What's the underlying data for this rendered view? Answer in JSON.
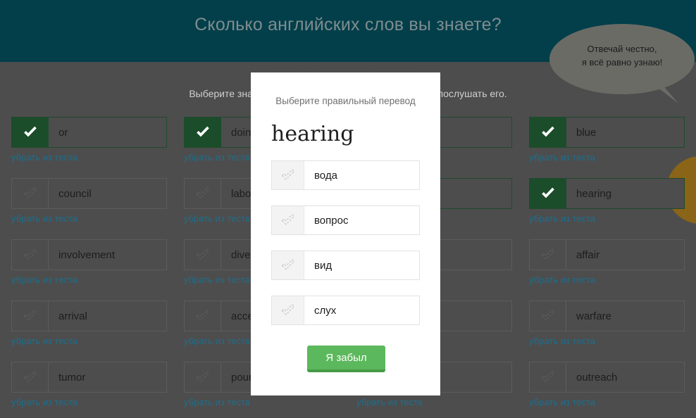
{
  "header": {
    "title": "Сколько английских слов вы знаете?",
    "bg_color": "#033f4a",
    "title_color": "#7e8c8f"
  },
  "mascot_bubble": {
    "line1": "Отвечай честно,",
    "line2": "я всё равно узнаю!",
    "bubble_color": "#6b6b66",
    "text_color": "#1b1b1b"
  },
  "page": {
    "background_color": "#4d4d4d",
    "instruction": "Выберите знакомые слова. Нажмите на слово, чтобы послушать его.",
    "remove_link_label": "убрать из теста",
    "link_color": "#1d6e8c",
    "selected_color": "#1b4d2b"
  },
  "word_grid": {
    "columns": 4,
    "rows": 5,
    "cells": [
      {
        "word": "or",
        "selected": true,
        "remove": "убрать из теста"
      },
      {
        "word": "doing",
        "selected": true,
        "remove": "убрать из теста"
      },
      {
        "word": "",
        "selected": true,
        "remove": ""
      },
      {
        "word": "blue",
        "selected": true,
        "remove": "убрать из теста"
      },
      {
        "word": "council",
        "selected": false,
        "remove": "убрать из теста"
      },
      {
        "word": "labor",
        "selected": false,
        "remove": "убрать из теста"
      },
      {
        "word": "",
        "selected": true,
        "remove": ""
      },
      {
        "word": "hearing",
        "selected": true,
        "remove": "убрать из теста"
      },
      {
        "word": "involvement",
        "selected": false,
        "remove": "убрать из теста"
      },
      {
        "word": "diversity",
        "selected": false,
        "remove": "убрать из теста"
      },
      {
        "word": "",
        "selected": false,
        "remove": ""
      },
      {
        "word": "affair",
        "selected": false,
        "remove": "убрать из теста"
      },
      {
        "word": "arrival",
        "selected": false,
        "remove": "убрать из теста"
      },
      {
        "word": "access",
        "selected": false,
        "remove": "убрать из теста"
      },
      {
        "word": "",
        "selected": false,
        "remove": ""
      },
      {
        "word": "warfare",
        "selected": false,
        "remove": "убрать из теста"
      },
      {
        "word": "tumor",
        "selected": false,
        "remove": "убрать из теста"
      },
      {
        "word": "pounding",
        "selected": false,
        "remove": "убрать из теста"
      },
      {
        "word": "",
        "selected": false,
        "remove": "убрать из теста"
      },
      {
        "word": "outreach",
        "selected": false,
        "remove": "убрать из теста"
      }
    ]
  },
  "modal": {
    "subtitle": "Выберите правильный перевод",
    "word": "hearing",
    "options": [
      {
        "label": "вода"
      },
      {
        "label": "вопрос"
      },
      {
        "label": "вид"
      },
      {
        "label": "слух"
      }
    ],
    "forgot_button_label": "Я забыл",
    "button_color": "#5cb85c",
    "button_shadow_color": "#479b47"
  }
}
